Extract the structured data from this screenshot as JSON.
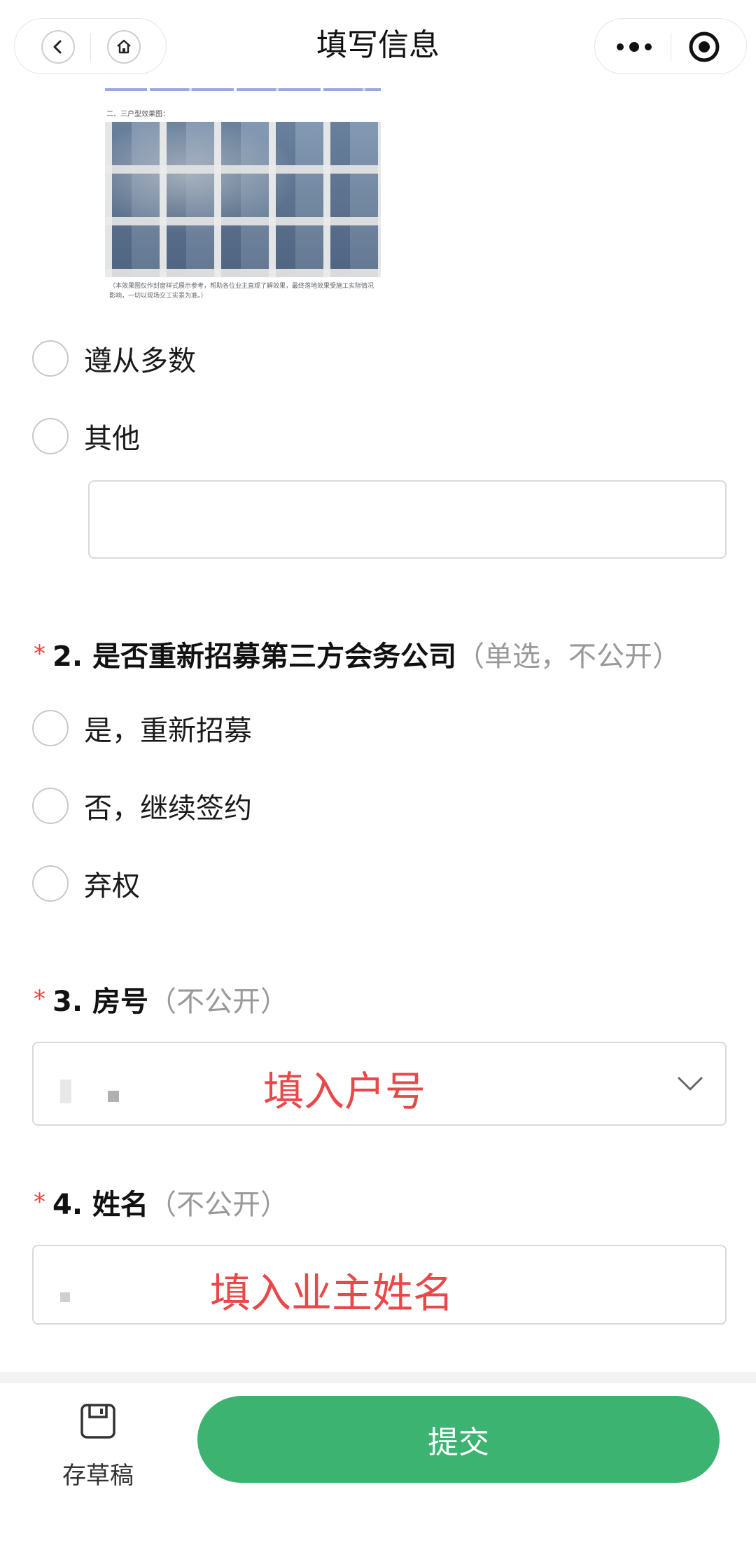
{
  "nav": {
    "title": "填写信息"
  },
  "image": {
    "caption": "二、三户型效果图：",
    "note": "（本效果图仅作封窗样式展示参考，帮助各位业主直观了解效果，最终落地效果受施工实际情况影响，一切以现场交工实景为准。）"
  },
  "q1": {
    "options": [
      "遵从多数",
      "其他"
    ],
    "other_input_value": ""
  },
  "q2": {
    "required_mark": "*",
    "title": "2. 是否重新招募第三方会务公司",
    "hint": "（单选，不公开）",
    "options": [
      "是，重新招募",
      "否，继续签约",
      "弃权"
    ]
  },
  "q3": {
    "required_mark": "*",
    "title": "3. 房号",
    "hint": "（不公开）",
    "annotation": "填入户号"
  },
  "q4": {
    "required_mark": "*",
    "title": "4. 姓名",
    "hint": "（不公开）",
    "annotation": "填入业主姓名"
  },
  "footer": {
    "draft_label": "存草稿",
    "submit_label": "提交"
  },
  "colors": {
    "accent": "#3cb371",
    "required": "#e8443a",
    "annotation": "#e8484a"
  }
}
